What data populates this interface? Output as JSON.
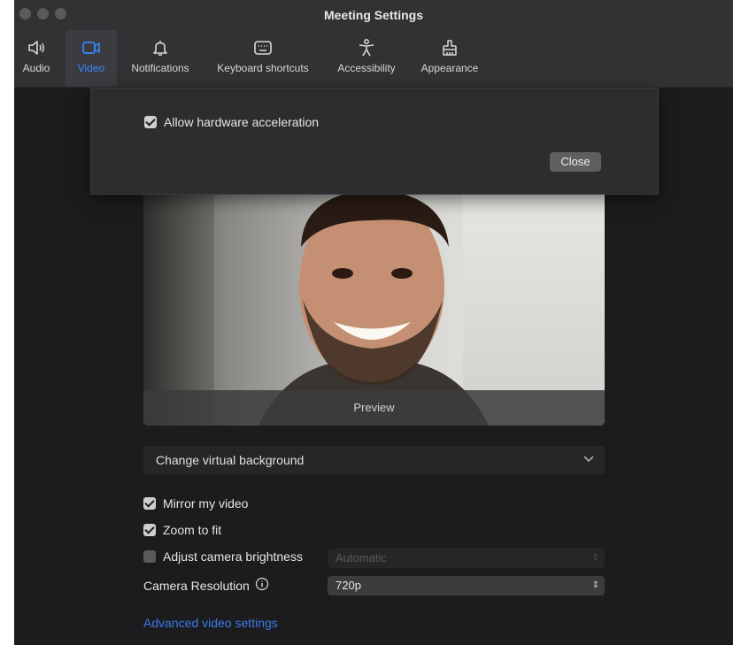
{
  "window": {
    "title": "Meeting Settings"
  },
  "tabs": [
    {
      "label": "Audio",
      "icon": "speaker-icon"
    },
    {
      "label": "Video",
      "icon": "video-camera-icon"
    },
    {
      "label": "Notifications",
      "icon": "bell-icon"
    },
    {
      "label": "Keyboard shortcuts",
      "icon": "keyboard-icon"
    },
    {
      "label": "Accessibility",
      "icon": "accessibility-icon"
    },
    {
      "label": "Appearance",
      "icon": "brush-icon"
    }
  ],
  "overlay": {
    "hardware_accel_label": "Allow hardware acceleration",
    "hardware_accel_checked": true,
    "close_label": "Close"
  },
  "preview": {
    "label": "Preview"
  },
  "virtual_background": {
    "label": "Change virtual background"
  },
  "options": {
    "mirror_label": "Mirror my video",
    "mirror_checked": true,
    "zoom_label": "Zoom to fit",
    "zoom_checked": true,
    "brightness_label": "Adjust camera brightness",
    "brightness_checked": false,
    "brightness_value": "Automatic",
    "resolution_label": "Camera Resolution",
    "resolution_value": "720p"
  },
  "advanced_link": "Advanced video settings",
  "colors": {
    "accent": "#3a86ff",
    "background": "#1c1c1e",
    "toolbar": "#323234",
    "link": "#3a7ae8"
  }
}
